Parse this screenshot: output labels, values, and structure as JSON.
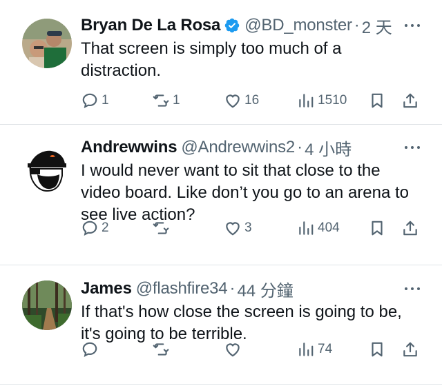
{
  "colors": {
    "text": "#0f1419",
    "secondary": "#536471",
    "verified": "#1d9bf0",
    "divider": "#dfe3e6"
  },
  "tweets": [
    {
      "name": "Bryan De La Rosa",
      "verified": true,
      "handle": "@BD_monster",
      "separator": "·",
      "time": "2 天",
      "text": "That screen is simply too much of a distraction.",
      "replies": "1",
      "retweets": "1",
      "likes": "16",
      "views": "1510"
    },
    {
      "name": "Andrewwins",
      "handle": "@Andrewwins2",
      "separator": "·",
      "time": "4 小時",
      "text": "I would never want to sit that close to the video board. Like don’t you go to an arena to see live action?",
      "replies": "2",
      "retweets": "",
      "likes": "3",
      "views": "404"
    },
    {
      "name": "James",
      "handle": "@flashfire34",
      "separator": "·",
      "time": "44 分鐘",
      "text": "If that's how close the screen is going to be, it's going to be terrible.",
      "replies": "",
      "retweets": "",
      "likes": "",
      "views": "74"
    }
  ],
  "icons": {
    "reply": "reply-icon",
    "retweet": "retweet-icon",
    "like": "heart-icon",
    "views": "views-icon",
    "bookmark": "bookmark-icon",
    "share": "share-icon",
    "more": "more-icon"
  }
}
